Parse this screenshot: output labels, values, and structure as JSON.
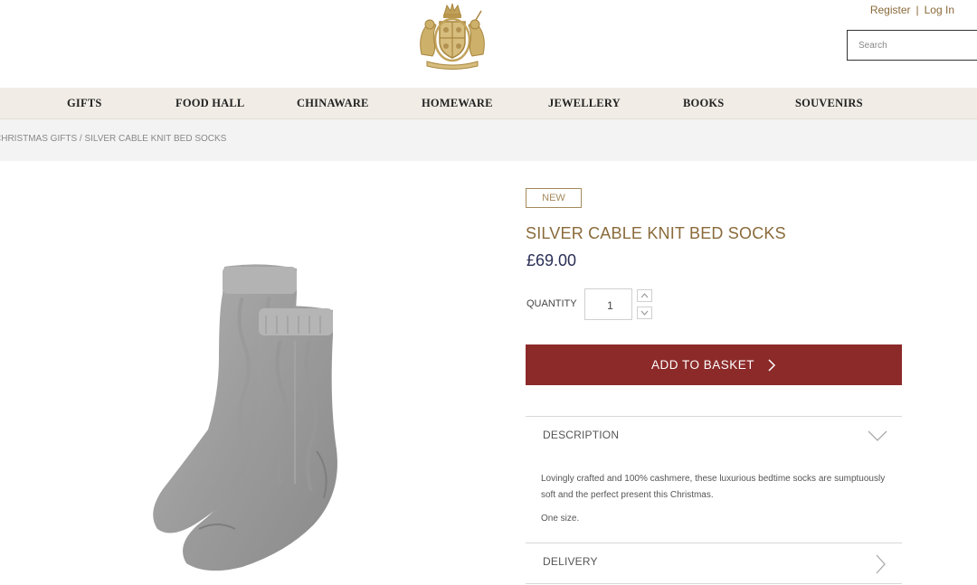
{
  "header": {
    "register_label": "Register",
    "separator": "|",
    "login_label": "Log In",
    "search_placeholder": "Search",
    "logo_icon": "royal-coat-of-arms-crest"
  },
  "nav": {
    "items": [
      {
        "label": "GIFTS"
      },
      {
        "label": "FOOD HALL"
      },
      {
        "label": "CHINAWARE"
      },
      {
        "label": "HOMEWARE"
      },
      {
        "label": "JEWELLERY"
      },
      {
        "label": "BOOKS"
      },
      {
        "label": "SOUVENIRS"
      }
    ]
  },
  "breadcrumb": {
    "text": "CHRISTMAS GIFTS / SILVER CABLE KNIT BED SOCKS"
  },
  "product": {
    "badge": "NEW",
    "title": "SILVER CABLE KNIT BED SOCKS",
    "price": "£69.00",
    "quantity_label": "QUANTITY",
    "quantity_value": "1",
    "add_to_basket_label": "ADD TO BASKET",
    "image_icon": "grey-cable-knit-socks"
  },
  "accordion": {
    "description": {
      "label": "DESCRIPTION",
      "text": "Lovingly crafted and 100% cashmere, these luxurious bedtime socks are sumptuously soft and the perfect present this Christmas.",
      "size": "One size."
    },
    "delivery": {
      "label": "DELIVERY"
    }
  },
  "colors": {
    "accent_gold": "#8a6a3a",
    "button_red": "#8c2a2a",
    "price_navy": "#2a2f55",
    "nav_bg": "#f1ede6"
  }
}
